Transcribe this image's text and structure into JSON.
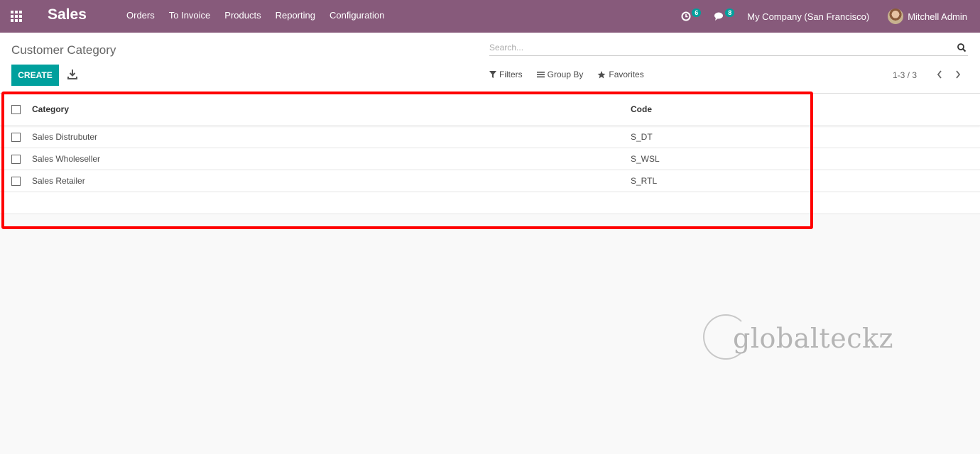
{
  "navbar": {
    "brand": "Sales",
    "menu": [
      "Orders",
      "To Invoice",
      "Products",
      "Reporting",
      "Configuration"
    ],
    "activity_count": "6",
    "message_count": "8",
    "company": "My Company (San Francisco)",
    "user": "Mitchell Admin",
    "colors": {
      "navbar": "#875a7b",
      "badge": "#00a09d"
    }
  },
  "control": {
    "breadcrumb": "Customer Category",
    "search_placeholder": "Search...",
    "create_label": "CREATE",
    "filters_label": "Filters",
    "groupby_label": "Group By",
    "favorites_label": "Favorites",
    "pager_value": "1-3 / 3",
    "prev_glyph": "‹",
    "next_glyph": "›",
    "colors": {
      "create": "#00a09d"
    }
  },
  "list": {
    "columns": {
      "name": "Category",
      "code": "Code"
    },
    "rows": [
      {
        "name": "Sales Distrubuter",
        "code": "S_DT"
      },
      {
        "name": "Sales Wholeseller",
        "code": "S_WSL"
      },
      {
        "name": "Sales Retailer",
        "code": "S_RTL"
      }
    ]
  },
  "annotation": {
    "color": "#ff0000"
  },
  "watermark": {
    "text": "globalteckz"
  }
}
